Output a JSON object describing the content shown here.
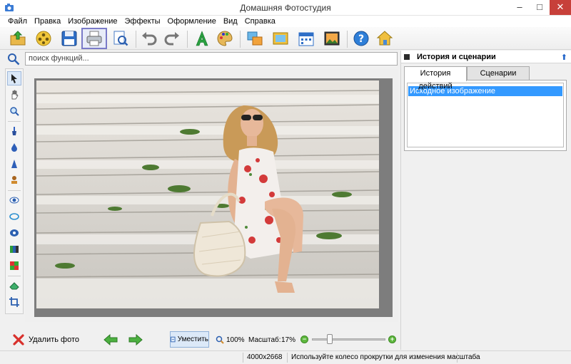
{
  "window": {
    "title": "Домашняя Фотостудия",
    "minimize": "–",
    "maximize": "□",
    "close": "✕"
  },
  "menu": [
    "Файл",
    "Правка",
    "Изображение",
    "Эффекты",
    "Оформление",
    "Вид",
    "Справка"
  ],
  "toolbar": {
    "buttons": [
      "open-icon",
      "film-icon",
      "save-icon",
      "print-icon",
      "preview-icon",
      "undo-icon",
      "redo-icon",
      "text-icon",
      "palette-icon",
      "collage-icon",
      "frame-icon",
      "calendar-icon",
      "photo-icon",
      "help-icon",
      "home-icon"
    ],
    "active": "print-icon"
  },
  "search": {
    "placeholder": "поиск функций..."
  },
  "tools": [
    "pointer-icon",
    "hand-icon",
    "zoom-icon",
    "brush-icon",
    "drop-icon",
    "sharpen-icon",
    "stamp-icon",
    "redeye-icon",
    "ring-icon",
    "eye-icon",
    "levels-icon",
    "colors-icon",
    "eraser-icon",
    "crop-icon"
  ],
  "right_panel": {
    "title": "История и сценарии",
    "pin": "⬆",
    "tabs": [
      "История действий",
      "Сценарии"
    ],
    "history": [
      "Исходное изображение"
    ]
  },
  "bottom": {
    "delete_label": "Удалить фото",
    "fit_label": "Уместить",
    "zoom100_label": "100%",
    "scale_label": "Масштаб:",
    "scale_value": "17%",
    "zoom_out": "−",
    "zoom_in": "+",
    "slider_value": 0.17
  },
  "status": {
    "dimensions": "4000x2668",
    "hint": "Используйте колесо прокрутки для изменения масштаба"
  },
  "colors": {
    "accent": "#3399ff",
    "close": "#c7403a",
    "canvas_frame": "#7d7d7d"
  }
}
